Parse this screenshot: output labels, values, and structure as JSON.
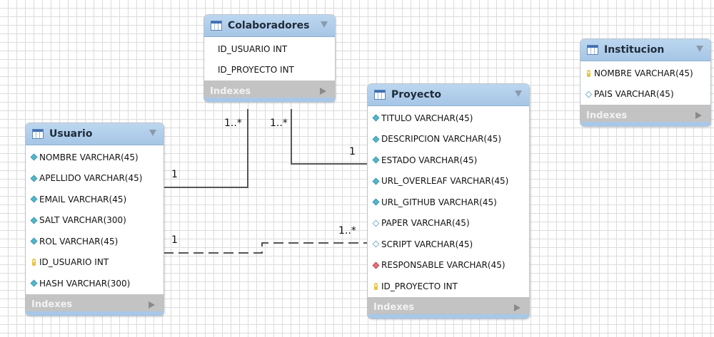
{
  "tables": {
    "usuario": {
      "title": "Usuario",
      "columns": [
        {
          "icon": "diamond-filled-icon",
          "text": "NOMBRE VARCHAR(45)"
        },
        {
          "icon": "diamond-filled-icon",
          "text": "APELLIDO VARCHAR(45)"
        },
        {
          "icon": "diamond-filled-icon",
          "text": "EMAIL VARCHAR(45)"
        },
        {
          "icon": "diamond-filled-icon",
          "text": "SALT VARCHAR(300)"
        },
        {
          "icon": "diamond-filled-icon",
          "text": "ROL VARCHAR(45)"
        },
        {
          "icon": "key-icon",
          "text": "ID_USUARIO INT"
        },
        {
          "icon": "diamond-filled-icon",
          "text": "HASH VARCHAR(300)"
        }
      ],
      "footer": "Indexes"
    },
    "colaboradores": {
      "title": "Colaboradores",
      "columns": [
        {
          "icon": "none",
          "text": "ID_USUARIO INT"
        },
        {
          "icon": "none",
          "text": "ID_PROYECTO INT"
        }
      ],
      "footer": "Indexes"
    },
    "proyecto": {
      "title": "Proyecto",
      "columns": [
        {
          "icon": "diamond-filled-icon",
          "text": "TITULO VARCHAR(45)"
        },
        {
          "icon": "diamond-filled-icon",
          "text": "DESCRIPCION VARCHAR(45)"
        },
        {
          "icon": "diamond-filled-icon",
          "text": "ESTADO VARCHAR(45)"
        },
        {
          "icon": "diamond-filled-icon",
          "text": "URL_OVERLEAF VARCHAR(45)"
        },
        {
          "icon": "diamond-filled-icon",
          "text": "URL_GITHUB VARCHAR(45)"
        },
        {
          "icon": "diamond-empty-icon",
          "text": "PAPER VARCHAR(45)"
        },
        {
          "icon": "diamond-empty-icon",
          "text": "SCRIPT VARCHAR(45)"
        },
        {
          "icon": "diamond-red-icon",
          "text": "RESPONSABLE VARCHAR(45)"
        },
        {
          "icon": "key-icon",
          "text": "ID_PROYECTO INT"
        }
      ],
      "footer": "Indexes"
    },
    "institucion": {
      "title": "Institucion",
      "columns": [
        {
          "icon": "key-icon",
          "text": "NOMBRE VARCHAR(45)"
        },
        {
          "icon": "diamond-empty-icon",
          "text": "PAIS VARCHAR(45)"
        }
      ],
      "footer": "Indexes"
    }
  },
  "relationships": [
    {
      "from": "usuario",
      "to": "colaboradores",
      "style": "solid",
      "from_label": "1",
      "to_label": "1..*"
    },
    {
      "from": "proyecto",
      "to": "colaboradores",
      "style": "solid",
      "from_label": "1",
      "to_label": "1..*"
    },
    {
      "from": "usuario",
      "to": "proyecto",
      "style": "dashed",
      "from_label": "1",
      "to_label": "1..*"
    }
  ],
  "colors": {
    "header": "#a6c6e6",
    "footer": "#c3c3c3",
    "grid": "#dcdcdc",
    "line": "#555555"
  }
}
